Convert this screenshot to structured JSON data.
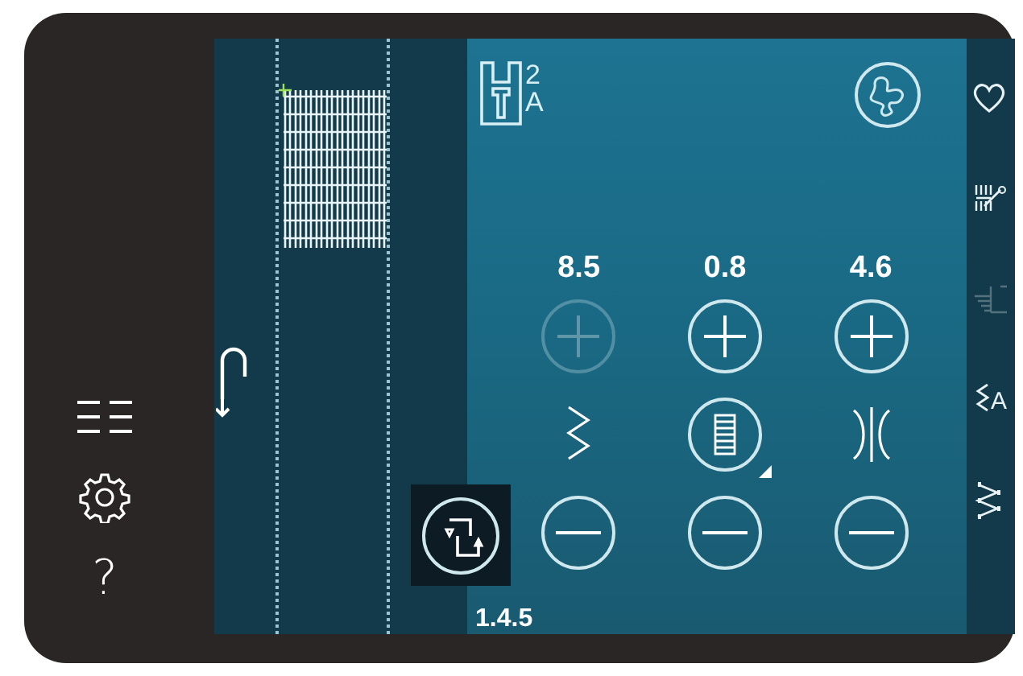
{
  "left_menu": [
    {
      "kind": "list"
    },
    {
      "kind": "settings"
    },
    {
      "kind": "help",
      "label": "?"
    }
  ],
  "presser_foot": {
    "number": "2",
    "letter": "A"
  },
  "settings": [
    {
      "value": "8.5",
      "plus_disabled": true,
      "minus_disabled": false,
      "kind": "stitch-width"
    },
    {
      "value": "0.8",
      "plus_disabled": false,
      "minus_disabled": false,
      "kind": "stitch-length"
    },
    {
      "value": "4.6",
      "plus_disabled": false,
      "minus_disabled": false,
      "kind": "positioning"
    }
  ],
  "stitch_number": "1.4.5",
  "right_bar": [
    {
      "kind": "favorite",
      "disabled": false
    },
    {
      "kind": "stitch-cut",
      "disabled": false
    },
    {
      "kind": "tapering",
      "disabled": true
    },
    {
      "kind": "text",
      "disabled": false,
      "label": "A"
    },
    {
      "kind": "stitch-program",
      "disabled": false
    }
  ]
}
